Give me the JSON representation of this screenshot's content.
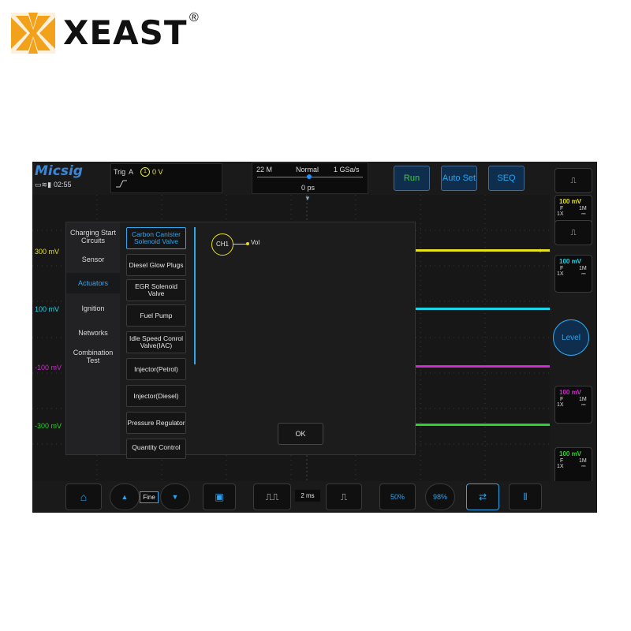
{
  "brand": {
    "name": "XEAST",
    "registered_mark": "®"
  },
  "device": {
    "logo": "Micsig",
    "time": "02:55",
    "status_icons": "monitor-icon wifi-icon battery-icon",
    "trigger": {
      "label": "Trig",
      "source": "A",
      "channel": "1",
      "value": "0 V"
    },
    "acquisition": {
      "memory": "22 M",
      "mode": "Normal",
      "sample_rate": "1 GSa/s",
      "position": "0 ps"
    },
    "buttons": {
      "run": "Run",
      "autoset": "Auto Set",
      "seq": "SEQ",
      "level": "Level",
      "ok": "OK",
      "fine": "Fine"
    },
    "volt_labels": [
      "300 mV",
      "100 mV",
      "-100 mV",
      "-300 mV"
    ],
    "categories": [
      "Charging Start Circuits",
      "Sensor",
      "Actuators",
      "Ignition",
      "Networks",
      "Combination Test"
    ],
    "active_category": "Actuators",
    "subitems": [
      "Carbon Canister Solenoid Valve",
      "Diesel Glow Plugs",
      "EGR Solenoid Valve",
      "Fuel Pump",
      "Idle Speed Conrol Valve(IAC)",
      "Injector(Petrol)",
      "Injector(Diesel)",
      "Pressure Regulator",
      "Quantity Control"
    ],
    "active_subitem": "Carbon Canister Solenoid Valve",
    "probe": {
      "channel": "CH1",
      "signal": "Vol"
    },
    "channels": [
      {
        "scale": "100 mV",
        "coupling": "F",
        "impedance": "1M",
        "probe": "1X",
        "dc": "⎓",
        "color": "#e6e01e"
      },
      {
        "scale": "100 mV",
        "coupling": "F",
        "impedance": "1M",
        "probe": "1X",
        "dc": "⎓",
        "color": "#1fd4e6"
      },
      {
        "scale": "100 mV",
        "coupling": "F",
        "impedance": "1M",
        "probe": "1X",
        "dc": "⎓",
        "color": "#cf2bcf"
      },
      {
        "scale": "100 mV",
        "coupling": "F",
        "impedance": "1M",
        "probe": "1X",
        "dc": "⎓",
        "color": "#2ed12e"
      }
    ],
    "timebase": "2 ms",
    "bottom_labels": {
      "p50": "50%",
      "p98": "98%"
    },
    "colors": {
      "accent": "#2ea7f0",
      "ch1": "#e6e01e",
      "ch2": "#1fd4e6",
      "ch3": "#cf2bcf",
      "ch4": "#2ed12e"
    }
  }
}
